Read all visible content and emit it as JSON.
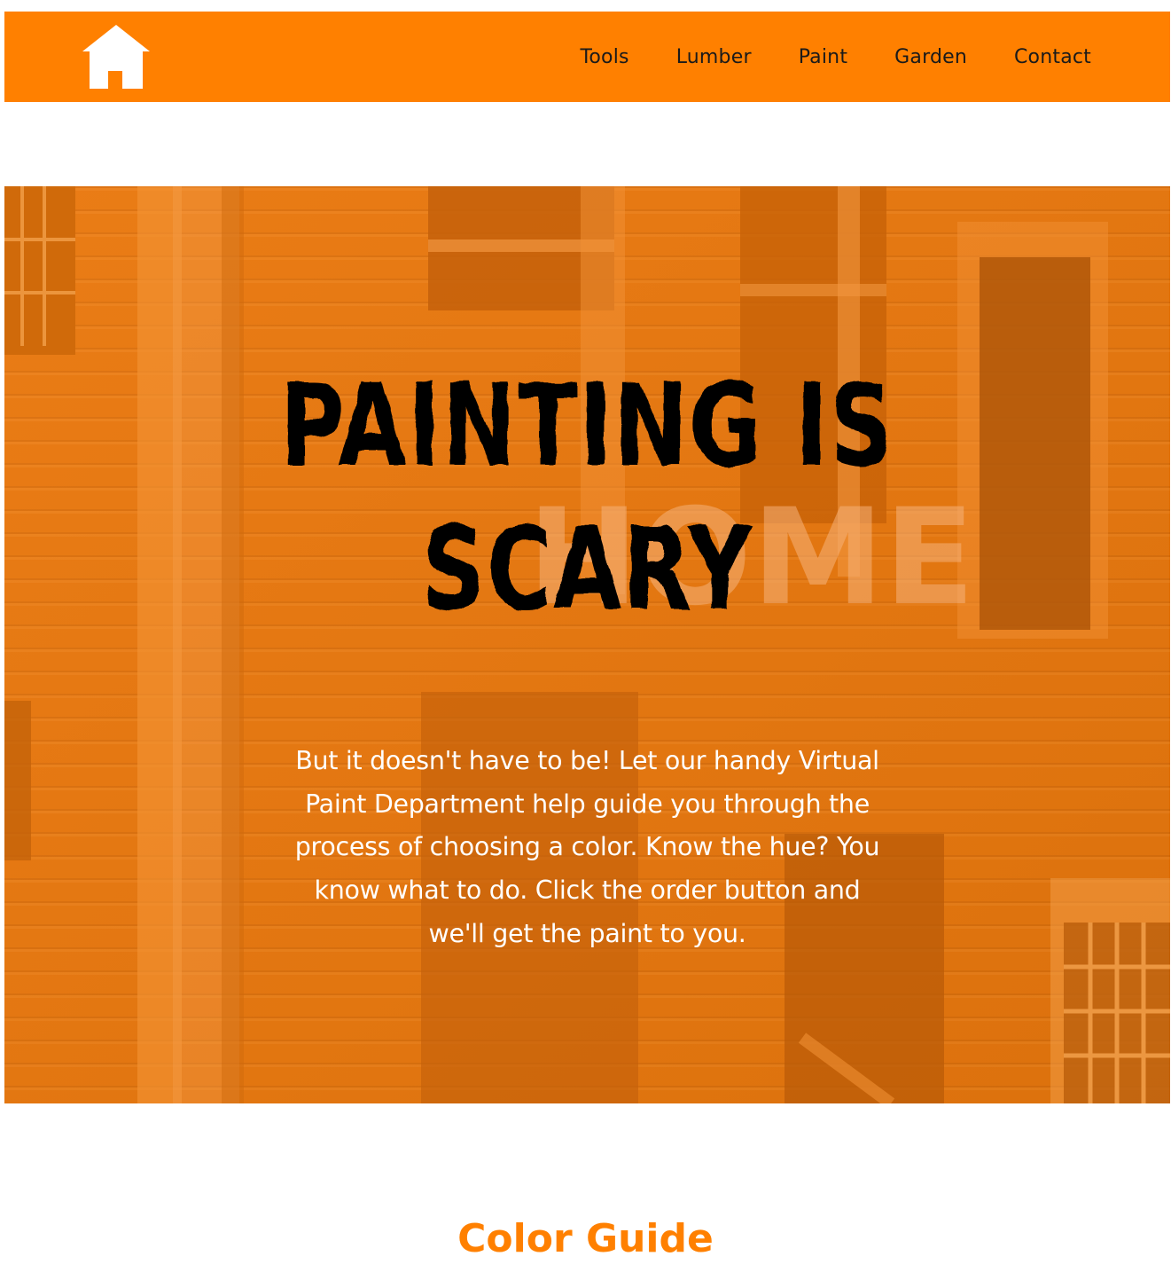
{
  "header": {
    "logo_icon": "home-icon",
    "nav": [
      {
        "label": "Tools"
      },
      {
        "label": "Lumber"
      },
      {
        "label": "Paint"
      },
      {
        "label": "Garden"
      },
      {
        "label": "Contact"
      }
    ]
  },
  "hero": {
    "title": "PAINTING IS SCARY",
    "body": "But it doesn't have to be! Let our handy Virtual Paint Department help guide you through the process of choosing a color. Know the hue? You know what to do. Click the order button and we'll get the paint to you."
  },
  "color_guide": {
    "title": "Color Guide"
  },
  "colors": {
    "brand_orange": "#ff8000",
    "hero_overlay": "#e87a10",
    "nav_text": "#1a1a1a",
    "hero_text": "#ffffff"
  }
}
